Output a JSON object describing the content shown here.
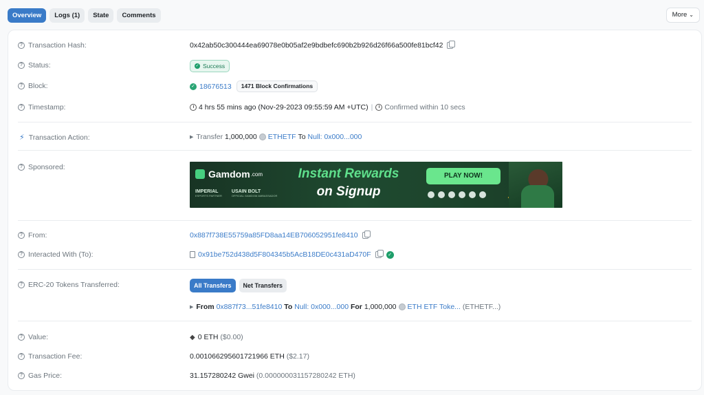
{
  "tabs": [
    {
      "label": "Overview",
      "active": true
    },
    {
      "label": "Logs (1)",
      "active": false
    },
    {
      "label": "State",
      "active": false
    },
    {
      "label": "Comments",
      "active": false
    }
  ],
  "more_label": "More",
  "colors": {
    "accent": "#3a7bc8",
    "success": "#1e9e6a",
    "muted": "#6c757d"
  },
  "overview": {
    "tx_hash": {
      "label": "Transaction Hash:",
      "value": "0x42ab50c300444ea69078e0b05af2e9bdbefc690b2b926d26f66a500fe81bcf42"
    },
    "status": {
      "label": "Status:",
      "value": "Success"
    },
    "block": {
      "label": "Block:",
      "number": "18676513",
      "confirmations": "1471 Block Confirmations"
    },
    "timestamp": {
      "label": "Timestamp:",
      "value": "4 hrs 55 mins ago (Nov-29-2023 09:55:59 AM +UTC)",
      "confirmed": "Confirmed within 10 secs"
    },
    "action": {
      "label": "Transaction Action:",
      "prefix": "Transfer",
      "amount": "1,000,000",
      "token": "ETHETF",
      "to_word": "To",
      "to_label": "Null: 0x000...000"
    },
    "sponsored": {
      "label": "Sponsored:"
    },
    "from": {
      "label": "From:",
      "value": "0x887f738E55759a85FD8aa14EB706052951fe8410"
    },
    "to": {
      "label": "Interacted With (To):",
      "value": "0x91be752d438d5F804345b5AcB18DE0c431aD470F"
    },
    "erc20": {
      "label": "ERC-20 Tokens Transferred:",
      "all_label": "All Transfers",
      "net_label": "Net Transfers",
      "from_word": "From",
      "from_addr": "0x887f73...51fe8410",
      "to_word": "To",
      "to_addr": "Null: 0x000...000",
      "for_word": "For",
      "amount": "1,000,000",
      "token": "ETH ETF Toke...",
      "token_symbol": "(ETHETF...)"
    },
    "value": {
      "label": "Value:",
      "amount": "0 ETH",
      "usd": "($0.00)"
    },
    "fee": {
      "label": "Transaction Fee:",
      "amount": "0.001066295601721966 ETH",
      "usd": "($2.17)"
    },
    "gas": {
      "label": "Gas Price:",
      "amount": "31.157280242 Gwei",
      "eth": "(0.000000031157280242 ETH)"
    }
  },
  "ad": {
    "brand": "Gamdom",
    "brand_suffix": ".com",
    "partner1": "IMPERIAL",
    "partner1_sub": "ESPORTS PARTNER",
    "partner2": "USAIN BOLT",
    "partner2_sub": "OFFICIAL GAMDOM AMBASSADOR",
    "headline1": "Instant Rewards",
    "headline2": "on Signup",
    "cta": "PLAY NOW!"
  }
}
